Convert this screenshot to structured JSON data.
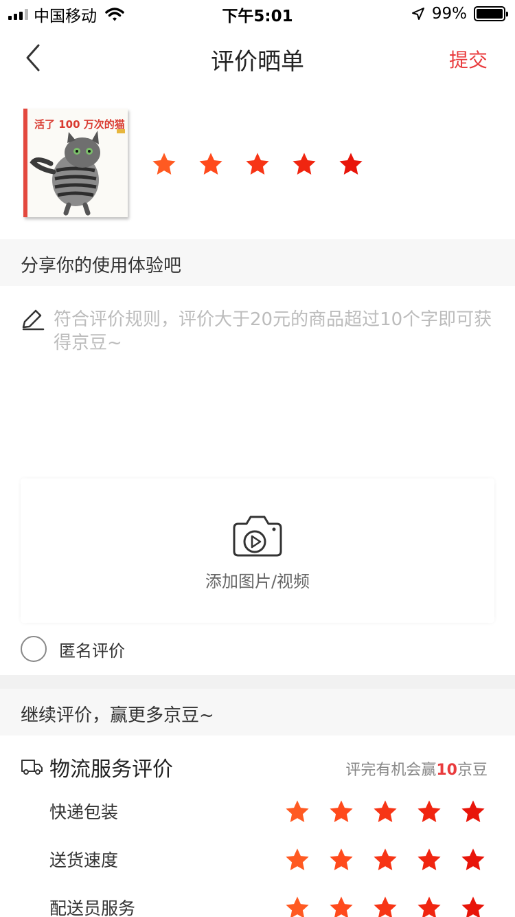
{
  "status_bar": {
    "carrier": "中国移动",
    "time": "下午5:01",
    "battery_percent": "99%",
    "signal_bars": 4,
    "signal_bars_active": 3,
    "icons": [
      "signal-icon",
      "wifi-icon",
      "location-icon",
      "battery-icon"
    ]
  },
  "nav": {
    "back_icon": "chevron-left-icon",
    "title": "评价晒单",
    "submit_label": "提交"
  },
  "product": {
    "cover_title": "活了 100 万次的猫",
    "rating": 5,
    "rating_max": 5
  },
  "share_section": {
    "title": "分享你的使用体验吧",
    "editor_icon": "pencil-icon",
    "placeholder": "符合评价规则，评价大于20元的商品超过10个字即可获得京豆~"
  },
  "upload": {
    "icon": "camera-video-icon",
    "label": "添加图片/视频"
  },
  "anonymous": {
    "label": "匿名评价",
    "checked": false
  },
  "continue_section": {
    "title": "继续评价，赢更多京豆~"
  },
  "logistics": {
    "icon": "truck-icon",
    "title": "物流服务评价",
    "hint_prefix": "评完有机会赢",
    "hint_count": "10",
    "hint_suffix": "京豆",
    "items": [
      {
        "label": "快递包装",
        "rating": 5
      },
      {
        "label": "送货速度",
        "rating": 5
      },
      {
        "label": "配送员服务",
        "rating": 5
      }
    ]
  },
  "colors": {
    "accent": "#e93b3d",
    "star_gradient": [
      "#ff5a22",
      "#ff4a1c",
      "#f73516",
      "#f02510",
      "#e8150a"
    ]
  }
}
